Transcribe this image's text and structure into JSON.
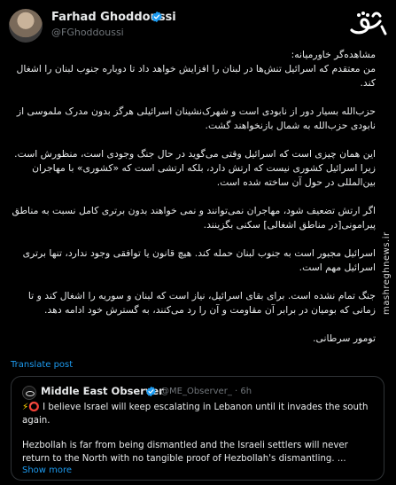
{
  "author": {
    "name": "Farhad Ghoddoussi",
    "handle": "@FGhoddoussi"
  },
  "watermark": "mashreghnews.ir",
  "post": {
    "paragraphs": [
      "مشاهده‌گر خاورمیانه:\nمن معتقدم که اسرائیل تنش‌ها در لبنان را افزایش خواهد داد تا دوباره جنوب لبنان را اشغال کند.",
      "حزب‌الله بسیار دور از نابودی است و شهرک‌نشینان اسرائیلی هرگز بدون مدرک ملموسی از نابودی حزب‌الله به شمال بازنخواهند گشت.",
      "این همان چیزی است که اسرائیل وقتی می‌گوید در حال جنگ وجودی است، منظورش است. زیرا اسرائیل کشوری نیست که ارتش دارد، بلکه ارتشی است که «کشوری» با مهاجران بین‌المللی در حول آن ساخته شده است.",
      "اگر ارتش تضعیف شود، مهاجران نمی‌توانند و نمی خواهند بدون برتری کامل نسبت به مناطق پیرامونی[در مناطق اشغالی] سکنی بگزینند.",
      "اسرائیل مجبور است به جنوب لبنان حمله کند. هیچ قانون یا توافقی وجود ندارد، تنها برتری اسرائیل مهم است.",
      "جنگ تمام نشده است. برای بقای اسرائیل، نیاز است که لبنان و سوریه را اشغال کند و تا زمانی که بومیان در برابر آن مقاومت و آن را رد می‌کنند، به گسترش خود ادامه دهد.",
      "تومور سرطانی."
    ],
    "translate_label": "Translate post"
  },
  "quote": {
    "name": "Middle East Observer",
    "handle": "@ME_Observer_ · 6h",
    "emoji_zap": "⚡",
    "emoji_circle": "⭕",
    "line1": " I believe Israel will keep escalating in Lebanon until it invades the south again.",
    "line2": "Hezbollah is far from being dismantled and the Israeli settlers will never return to the North with no tangible proof of Hezbollah's dismantling. ...",
    "show_more": "Show more"
  },
  "colors": {
    "background": "#000000",
    "text": "#e7e9ea",
    "muted": "#71767b",
    "link": "#1d9bf0",
    "verified": "#1d9bf0",
    "border": "#2f3336"
  }
}
